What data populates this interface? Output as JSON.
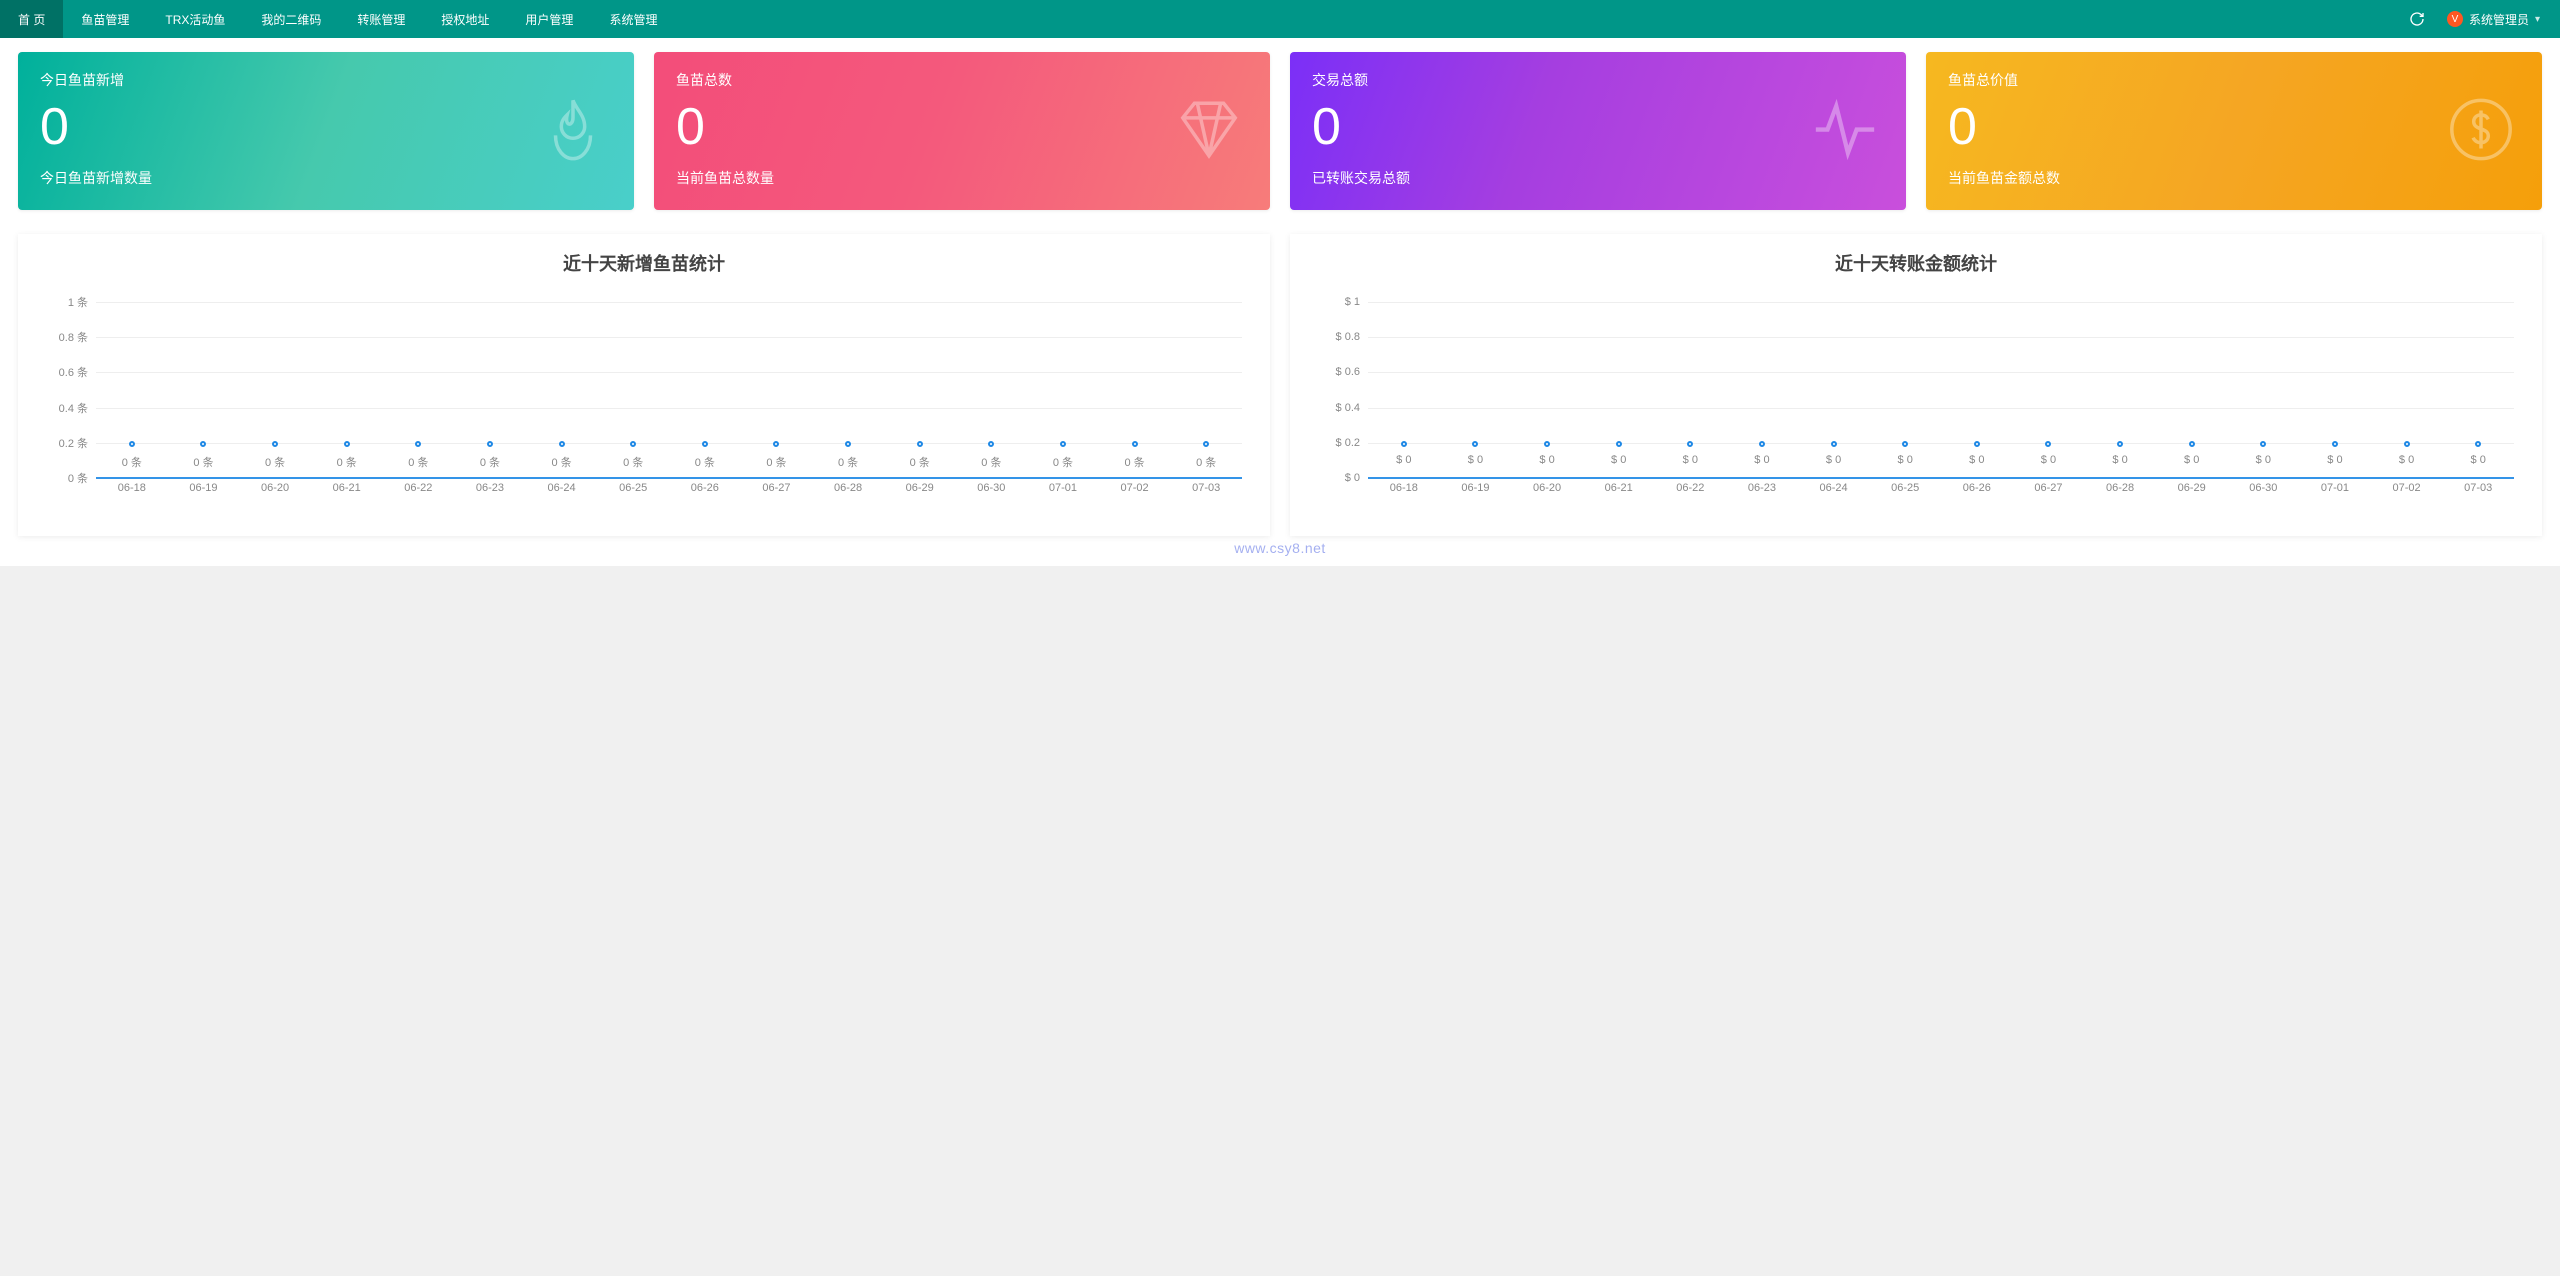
{
  "nav": {
    "items": [
      {
        "label": "首 页",
        "active": true
      },
      {
        "label": "鱼苗管理",
        "active": false
      },
      {
        "label": "TRX活动鱼",
        "active": false
      },
      {
        "label": "我的二维码",
        "active": false
      },
      {
        "label": "转账管理",
        "active": false
      },
      {
        "label": "授权地址",
        "active": false
      },
      {
        "label": "用户管理",
        "active": false
      },
      {
        "label": "系统管理",
        "active": false
      }
    ],
    "user_label": "系统管理员",
    "avatar_letter": "V"
  },
  "cards": [
    {
      "title": "今日鱼苗新增",
      "value": "0",
      "desc": "今日鱼苗新增数量",
      "grad": "g-green",
      "icon": "fire"
    },
    {
      "title": "鱼苗总数",
      "value": "0",
      "desc": "当前鱼苗总数量",
      "grad": "g-pink",
      "icon": "diamond"
    },
    {
      "title": "交易总额",
      "value": "0",
      "desc": "已转账交易总额",
      "grad": "g-purple",
      "icon": "pulse"
    },
    {
      "title": "鱼苗总价值",
      "value": "0",
      "desc": "当前鱼苗金额总数",
      "grad": "g-orange",
      "icon": "dollar"
    }
  ],
  "chart_data": [
    {
      "type": "line",
      "title": "近十天新增鱼苗统计",
      "xlabel": "",
      "ylabel": "",
      "categories": [
        "06-18",
        "06-19",
        "06-20",
        "06-21",
        "06-22",
        "06-23",
        "06-24",
        "06-25",
        "06-26",
        "06-27",
        "06-28",
        "06-29",
        "06-30",
        "07-01",
        "07-02",
        "07-03"
      ],
      "values": [
        0,
        0,
        0,
        0,
        0,
        0,
        0,
        0,
        0,
        0,
        0,
        0,
        0,
        0,
        0,
        0
      ],
      "point_label_suffix": " 条",
      "y_ticks": [
        "1 条",
        "0.8 条",
        "0.6 条",
        "0.4 条",
        "0.2 条",
        "0 条"
      ],
      "ylim": [
        0,
        1
      ]
    },
    {
      "type": "line",
      "title": "近十天转账金额统计",
      "xlabel": "",
      "ylabel": "",
      "categories": [
        "06-18",
        "06-19",
        "06-20",
        "06-21",
        "06-22",
        "06-23",
        "06-24",
        "06-25",
        "06-26",
        "06-27",
        "06-28",
        "06-29",
        "06-30",
        "07-01",
        "07-02",
        "07-03"
      ],
      "values": [
        0,
        0,
        0,
        0,
        0,
        0,
        0,
        0,
        0,
        0,
        0,
        0,
        0,
        0,
        0,
        0
      ],
      "point_label_prefix": "$ ",
      "y_ticks": [
        "$ 1",
        "$ 0.8",
        "$ 0.6",
        "$ 0.4",
        "$ 0.2",
        "$ 0"
      ],
      "ylim": [
        0,
        1
      ]
    }
  ],
  "watermark": "www.csy8.net"
}
